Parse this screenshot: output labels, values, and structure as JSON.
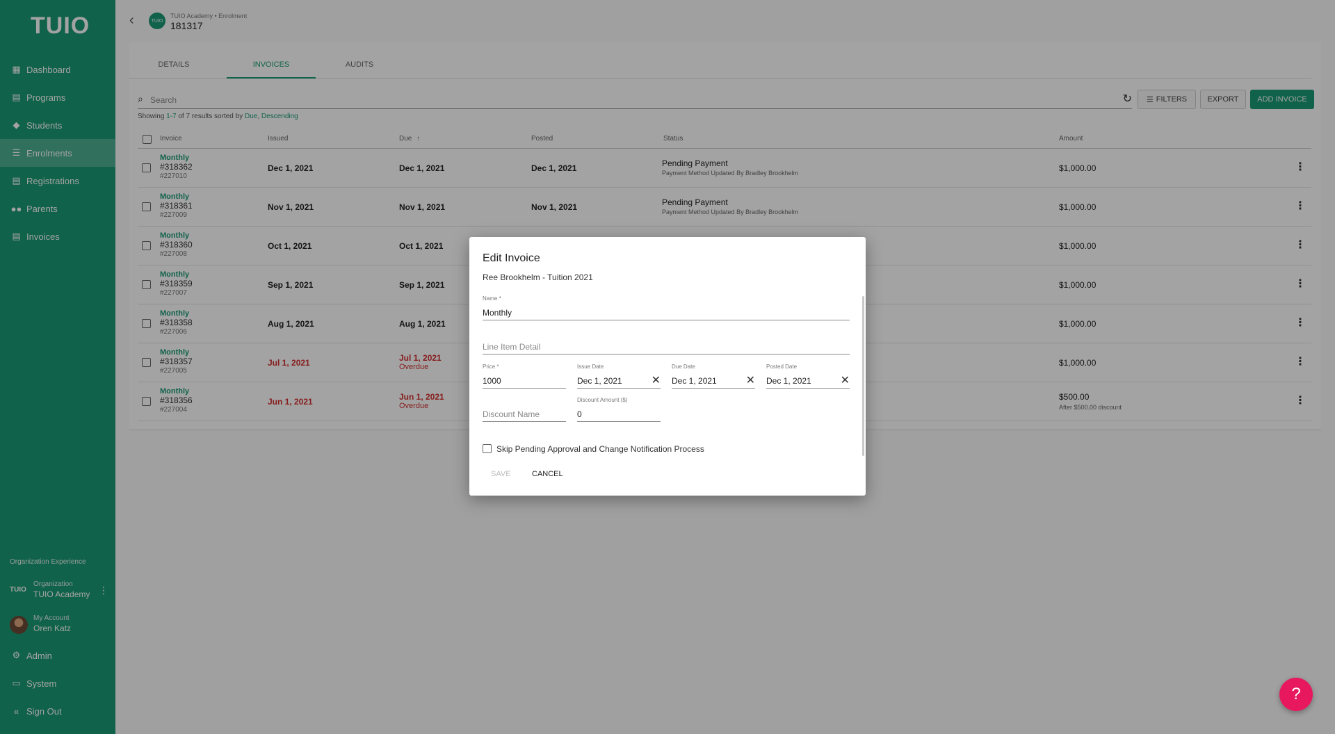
{
  "sidebar": {
    "logo": "TUIO",
    "nav": [
      {
        "label": "Dashboard",
        "icon": "dashboard-icon"
      },
      {
        "label": "Programs",
        "icon": "programs-icon"
      },
      {
        "label": "Students",
        "icon": "students-icon"
      },
      {
        "label": "Enrolments",
        "icon": "enrolments-icon"
      },
      {
        "label": "Registrations",
        "icon": "registrations-icon"
      },
      {
        "label": "Parents",
        "icon": "parents-icon"
      },
      {
        "label": "Invoices",
        "icon": "invoices-icon"
      }
    ],
    "org_experience": "Organization Experience",
    "org": {
      "logo": "TUIO",
      "small": "Organization",
      "name": "TUIO Academy"
    },
    "account": {
      "small": "My Account",
      "name": "Oren Katz"
    },
    "bottom": [
      {
        "label": "Admin",
        "icon": "gear-icon"
      },
      {
        "label": "System",
        "icon": "monitor-icon"
      },
      {
        "label": "Sign Out",
        "icon": "sign-out-icon"
      }
    ]
  },
  "header": {
    "badge": "TUIO",
    "breadcrumb": "TUIO Academy • Enrolment",
    "id": "181317"
  },
  "tabs": [
    "DETAILS",
    "INVOICES",
    "AUDITS"
  ],
  "toolbar": {
    "search_placeholder": "Search",
    "filters": "FILTERS",
    "export": "EXPORT",
    "add": "ADD INVOICE"
  },
  "results": {
    "prefix": "Showing ",
    "range": "1-7",
    "middle": " of 7 results sorted by ",
    "field": "Due",
    "sep": ", ",
    "order": "Descending"
  },
  "columns": {
    "invoice": "Invoice",
    "issued": "Issued",
    "due": "Due",
    "due_sort": "↑",
    "posted": "Posted",
    "status": "Status",
    "amount": "Amount"
  },
  "rows": [
    {
      "name": "Monthly",
      "num": "#318362",
      "sub": "#227010",
      "issued": "Dec 1, 2021",
      "due": "Dec 1, 2021",
      "posted": "Dec 1, 2021",
      "status": "Pending Payment",
      "status_sub": "Payment Method Updated By Bradley Brookhelm",
      "amount": "$1,000.00"
    },
    {
      "name": "Monthly",
      "num": "#318361",
      "sub": "#227009",
      "issued": "Nov 1, 2021",
      "due": "Nov 1, 2021",
      "posted": "Nov 1, 2021",
      "status": "Pending Payment",
      "status_sub": "Payment Method Updated By Bradley Brookhelm",
      "amount": "$1,000.00"
    },
    {
      "name": "Monthly",
      "num": "#318360",
      "sub": "#227008",
      "issued": "Oct 1, 2021",
      "due": "Oct 1, 2021",
      "amount": "$1,000.00"
    },
    {
      "name": "Monthly",
      "num": "#318359",
      "sub": "#227007",
      "issued": "Sep 1, 2021",
      "due": "Sep 1, 2021",
      "amount": "$1,000.00"
    },
    {
      "name": "Monthly",
      "num": "#318358",
      "sub": "#227006",
      "issued": "Aug 1, 2021",
      "due": "Aug 1, 2021",
      "amount": "$1,000.00"
    },
    {
      "name": "Monthly",
      "num": "#318357",
      "sub": "#227005",
      "issued": "Jul 1, 2021",
      "due": "Jul 1, 2021",
      "due_sub": "Overdue",
      "amount": "$1,000.00"
    },
    {
      "name": "Monthly",
      "num": "#318356",
      "sub": "#227004",
      "issued": "Jun 1, 2021",
      "due": "Jun 1, 2021",
      "due_sub": "Overdue",
      "amount": "$500.00",
      "amount_sub": "After $500.00 discount"
    }
  ],
  "modal": {
    "title": "Edit Invoice",
    "subtitle": "Ree Brookhelm - Tuition 2021",
    "name_label": "Name *",
    "name_value": "Monthly",
    "line_item_placeholder": "Line Item Detail",
    "price_label": "Price *",
    "price_value": "1000",
    "issue_label": "Issue Date",
    "issue_value": "Dec 1, 2021",
    "due_label": "Due Date",
    "due_value": "Dec 1, 2021",
    "posted_label": "Posted Date",
    "posted_value": "Dec 1, 2021",
    "discount_name_placeholder": "Discount Name",
    "discount_amount_label": "Discount Amount ($)",
    "discount_amount_value": "0",
    "skip_label": "Skip Pending Approval and Change Notification Process",
    "save": "SAVE",
    "cancel": "CANCEL"
  },
  "help": "?"
}
